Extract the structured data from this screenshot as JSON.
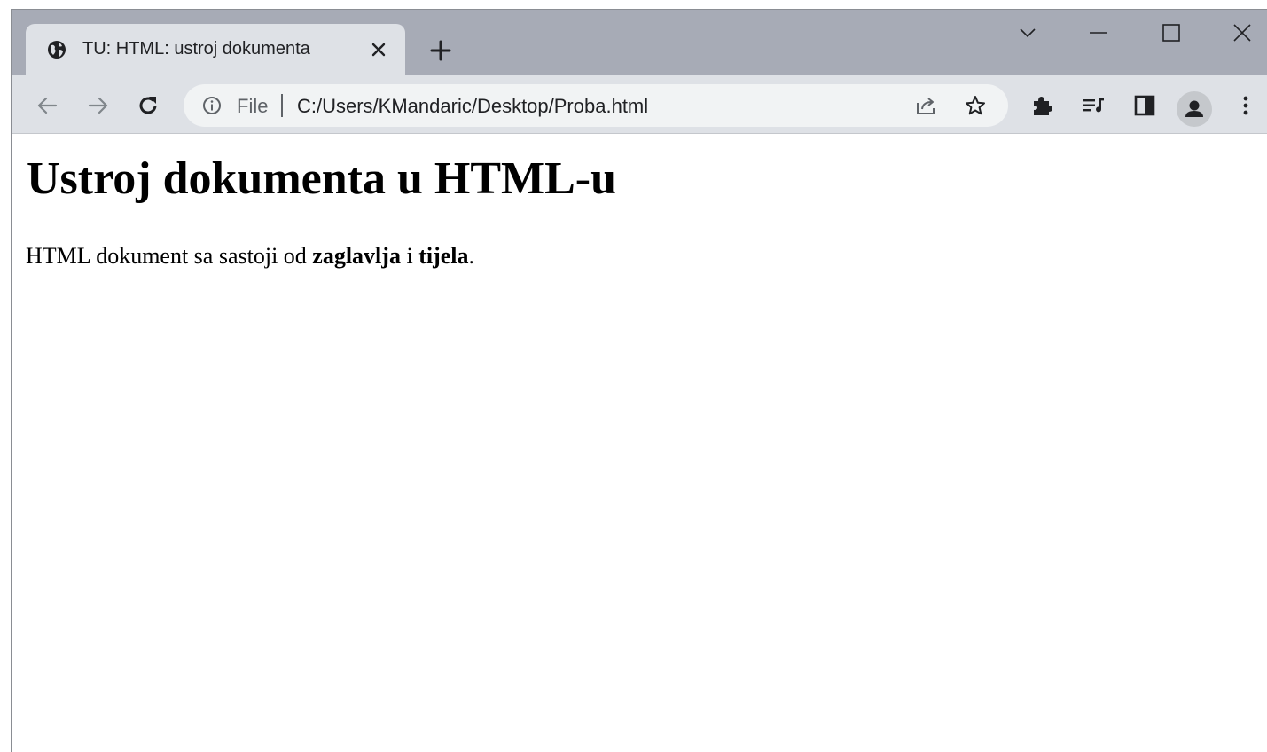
{
  "browser": {
    "tab": {
      "title": "TU: HTML: ustroj dokumenta"
    },
    "address_bar": {
      "scheme_label": "File",
      "url": "C:/Users/KMandaric/Desktop/Proba.html"
    },
    "colors": {
      "tabstrip": "#a7abb6",
      "toolbar": "#dee1e6",
      "omnibox": "#f1f3f4",
      "icon": "#5f6368"
    },
    "icons": {
      "tab_favicon": "globe-icon",
      "tab_close": "close-icon",
      "new_tab": "plus-icon",
      "tab_search": "chevron-down-icon",
      "minimize": "minimize-icon",
      "maximize": "maximize-icon",
      "close_window": "close-window-icon",
      "back": "back-arrow-icon",
      "forward": "forward-arrow-icon",
      "reload": "reload-icon",
      "site_info": "info-icon",
      "share": "share-icon",
      "bookmark": "star-icon",
      "extensions": "puzzle-icon",
      "reading_list": "reading-list-icon",
      "side_panel": "side-panel-icon",
      "profile": "person-icon",
      "menu": "kebab-menu-icon"
    }
  },
  "page": {
    "heading": "Ustroj dokumenta u HTML-u",
    "paragraph": {
      "text_before": "HTML dokument sa sastoji od ",
      "bold_1": "zaglavlja",
      "text_middle": " i ",
      "bold_2": "tijela",
      "text_end": "."
    }
  }
}
